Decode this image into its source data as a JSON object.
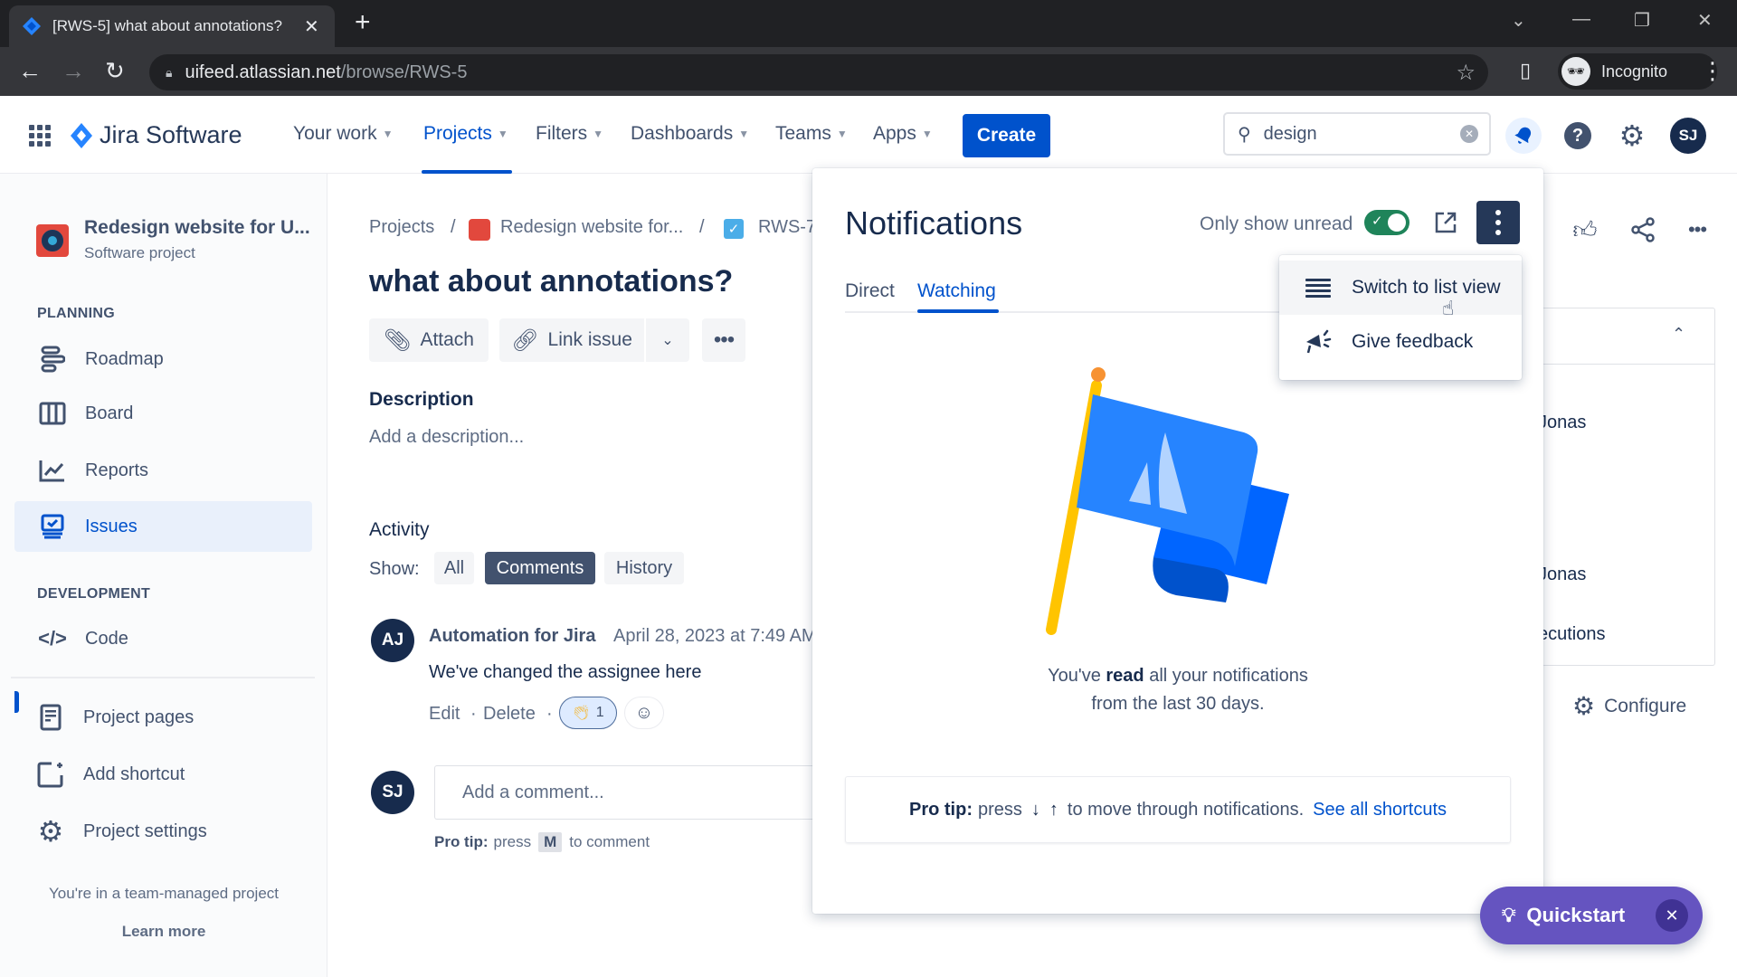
{
  "browser": {
    "tab_title": "[RWS-5] what about annotations?",
    "url_host": "uifeed.atlassian.net",
    "url_path": "/browse/RWS-5",
    "profile_label": "Incognito"
  },
  "header": {
    "product": "Jira Software",
    "nav": [
      "Your work",
      "Projects",
      "Filters",
      "Dashboards",
      "Teams",
      "Apps"
    ],
    "active_nav": "Projects",
    "create_label": "Create",
    "search_value": "design",
    "avatar_initials": "SJ"
  },
  "sidebar": {
    "project_name": "Redesign website for U...",
    "project_type": "Software project",
    "planning_label": "PLANNING",
    "planning_items": [
      {
        "label": "Roadmap",
        "icon": "roadmap-icon"
      },
      {
        "label": "Board",
        "icon": "board-icon"
      },
      {
        "label": "Reports",
        "icon": "reports-icon"
      },
      {
        "label": "Issues",
        "icon": "issues-icon",
        "active": true
      }
    ],
    "development_label": "DEVELOPMENT",
    "development_items": [
      {
        "label": "Code",
        "icon": "code-icon"
      }
    ],
    "other_items": [
      {
        "label": "Project pages",
        "icon": "page-icon"
      },
      {
        "label": "Add shortcut",
        "icon": "add-shortcut-icon"
      },
      {
        "label": "Project settings",
        "icon": "gear-icon"
      }
    ],
    "footer_text": "You're in a team-managed project",
    "learn_more": "Learn more"
  },
  "issue": {
    "breadcrumb": [
      "Projects",
      "Redesign website for...",
      "RWS-7"
    ],
    "title": "what about annotations?",
    "actions": {
      "attach": "Attach",
      "link_issue": "Link issue"
    },
    "description_label": "Description",
    "description_placeholder": "Add a description...",
    "activity_label": "Activity",
    "show_label": "Show:",
    "filters": [
      "All",
      "Comments",
      "History"
    ],
    "active_filter": "Comments",
    "comment": {
      "avatar": "AJ",
      "author": "Automation for Jira",
      "timestamp": "April 28, 2023 at 7:49 AM",
      "body": "We've changed the assignee here",
      "edit": "Edit",
      "delete": "Delete",
      "reaction_count": "1"
    },
    "new_comment": {
      "avatar": "SJ",
      "placeholder": "Add a comment...",
      "protip_bold": "Pro tip:",
      "protip_pre": "press",
      "protip_key": "M",
      "protip_post": "to comment"
    }
  },
  "notifications": {
    "title": "Notifications",
    "only_unread_label": "Only show unread",
    "only_unread_on": true,
    "tabs": [
      "Direct",
      "Watching"
    ],
    "active_tab": "Watching",
    "empty_pre": "You've ",
    "empty_bold": "read",
    "empty_post": " all your notifications",
    "empty_line2": "from the last 30 days.",
    "protip_bold": "Pro tip:",
    "protip_pre": "press",
    "protip_down": "↓",
    "protip_up": "↑",
    "protip_post": "to move through notifications.",
    "protip_link": "See all shortcuts",
    "menu": [
      {
        "label": "Switch to list view",
        "icon": "list-icon"
      },
      {
        "label": "Give feedback",
        "icon": "megaphone-icon"
      }
    ]
  },
  "right_panel": {
    "rows": [
      "Jonas",
      "Jonas",
      "ecutions"
    ],
    "configure": "Configure"
  },
  "quickstart": {
    "label": "Quickstart"
  },
  "colors": {
    "brand": "#0052cc",
    "toggle_on": "#1f845a",
    "quickstart": "#6554c0",
    "flag_blue": "#2684ff",
    "flag_pole": "#ffc400"
  }
}
